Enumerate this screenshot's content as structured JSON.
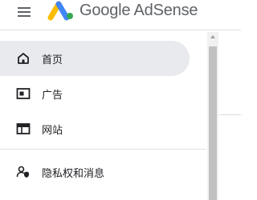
{
  "header": {
    "menu_icon": "hamburger-menu-icon",
    "logo_icon": "google-adsense-logo-icon",
    "product_name": "Google AdSense",
    "brand_colors": [
      "#fbbc04",
      "#4285f4",
      "#34a853"
    ]
  },
  "sidebar": {
    "items": [
      {
        "label": "首页",
        "icon": "home-icon",
        "active": true
      },
      {
        "label": "广告",
        "icon": "ads-icon",
        "active": false
      },
      {
        "label": "网站",
        "icon": "sites-icon",
        "active": false
      },
      {
        "label": "隐私权和消息",
        "icon": "privacy-messaging-icon",
        "active": false
      }
    ],
    "active_bg": "#e8eaed"
  }
}
